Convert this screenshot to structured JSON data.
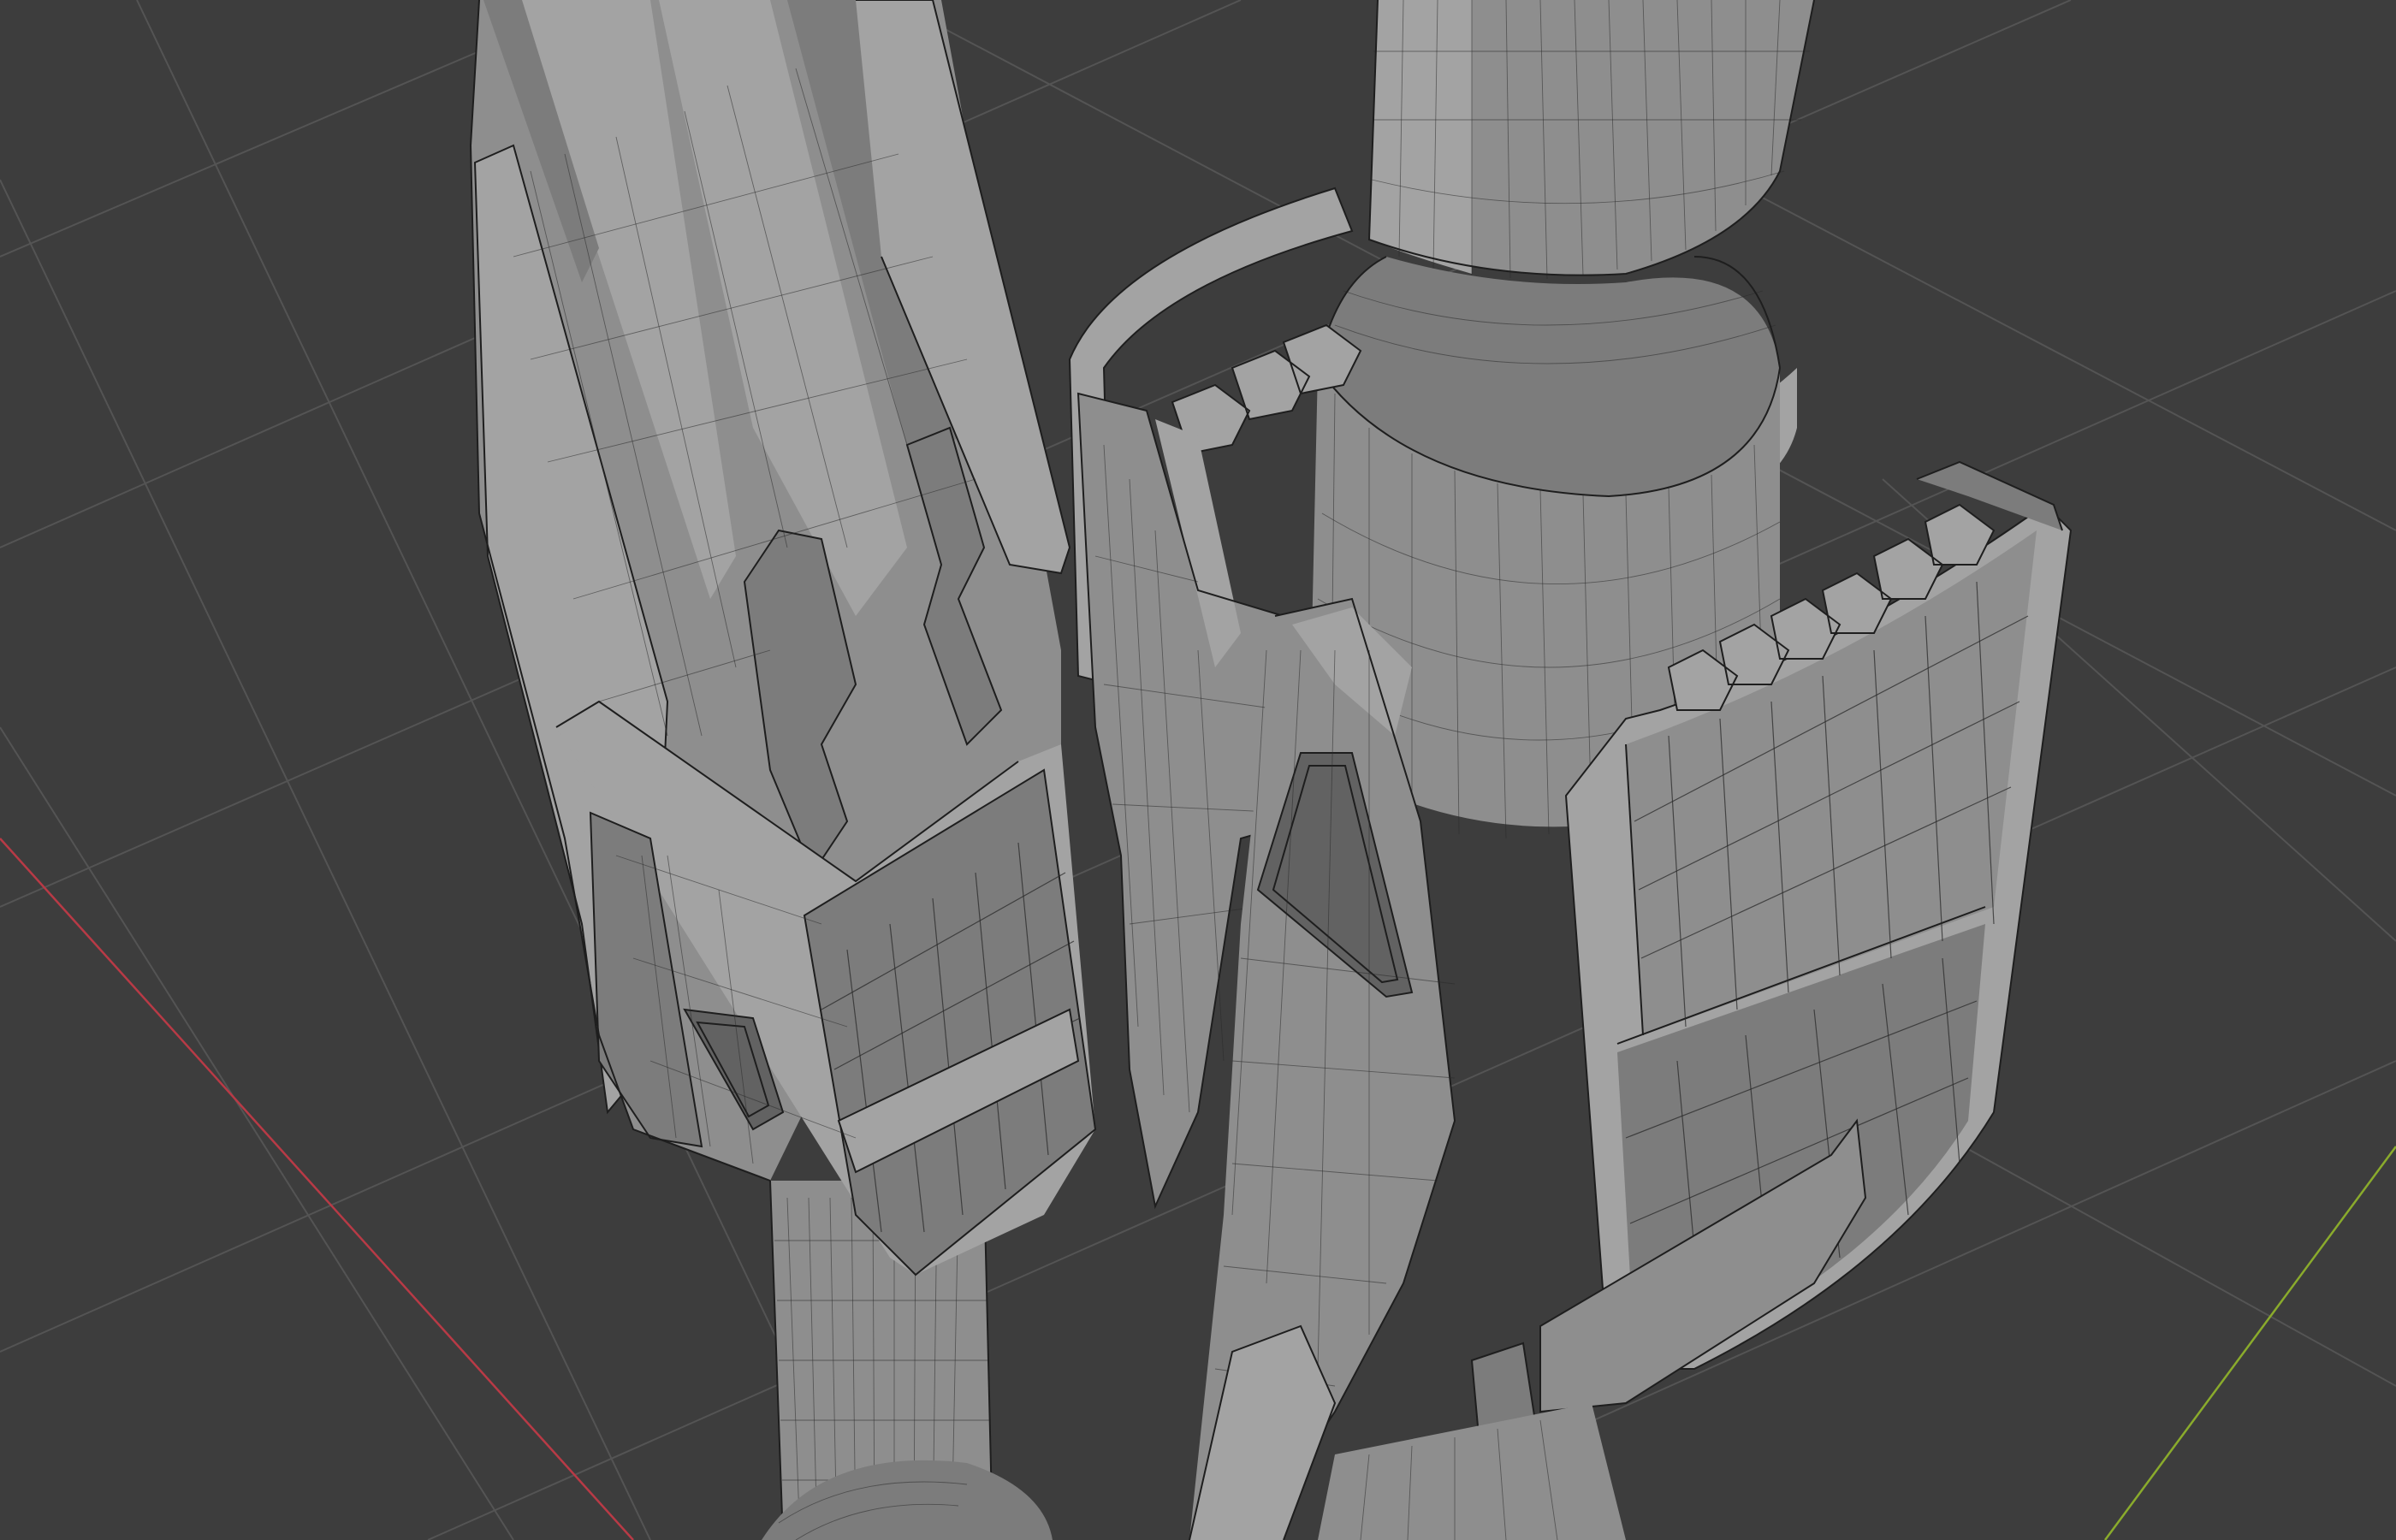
{
  "viewport": {
    "mode": "3d-viewport",
    "shading": "solid-wireframe-overlay",
    "background_color": "#3d3d3d",
    "grid_color": "#545454",
    "x_axis_color": "#b83a46",
    "y_axis_color": "#8aab2c",
    "mesh_color": "#8e8e8e"
  },
  "objects": [
    {
      "id": "left-leg-mesh",
      "kind": "mechanical-leg"
    },
    {
      "id": "right-leg-mesh",
      "kind": "mechanical-leg"
    }
  ]
}
